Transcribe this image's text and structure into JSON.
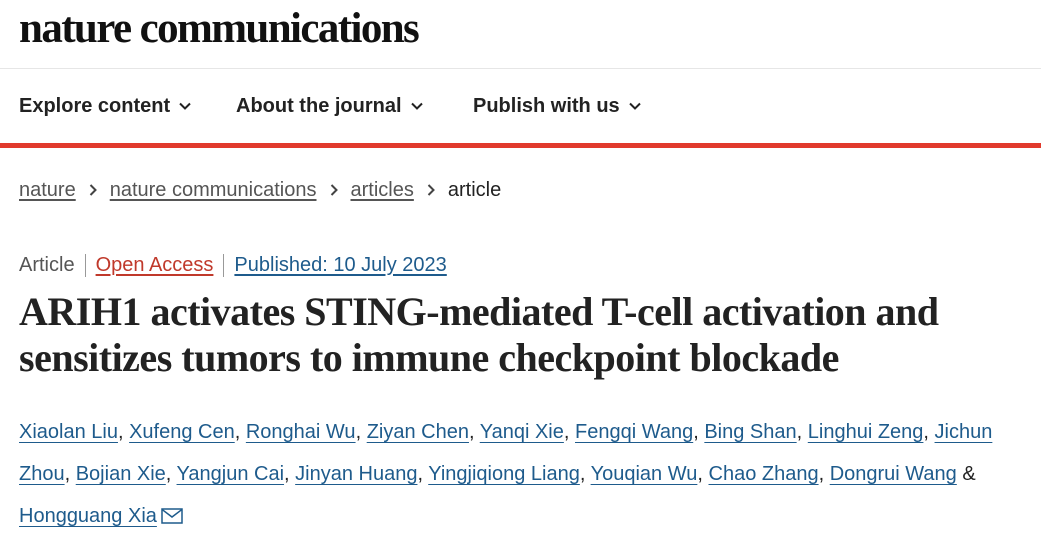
{
  "site": {
    "logo_text": "nature communications"
  },
  "nav": {
    "items": [
      {
        "label": "Explore content"
      },
      {
        "label": "About the journal"
      },
      {
        "label": "Publish with us"
      }
    ]
  },
  "breadcrumb": {
    "items": [
      "nature",
      "nature communications",
      "articles"
    ],
    "current": "article"
  },
  "article": {
    "type": "Article",
    "access": "Open Access",
    "published": "Published: 10 July 2023",
    "title": "ARIH1 activates STING-mediated T-cell activation and sensitizes tumors to immune checkpoint blockade",
    "authors": [
      "Xiaolan Liu",
      "Xufeng Cen",
      "Ronghai Wu",
      "Ziyan Chen",
      "Yanqi Xie",
      "Fengqi Wang",
      "Bing Shan",
      "Linghui Zeng",
      "Jichun Zhou",
      "Bojian Xie",
      "Yangjun Cai",
      "Jinyan Huang",
      "Yingjiqiong Liang",
      "Youqian Wu",
      "Chao Zhang",
      "Dongrui Wang",
      "Hongguang Xia"
    ],
    "author_separator": ", ",
    "last_author_separator": " & ",
    "corresponding_icon": "mail-icon"
  },
  "colors": {
    "accent_bar": "#e13a2d",
    "link_blue": "#1e5b8c",
    "open_access": "#c0392b",
    "muted_text": "#555555"
  }
}
